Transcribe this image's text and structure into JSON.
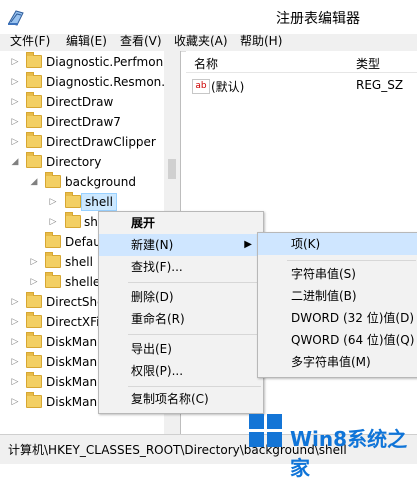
{
  "window": {
    "title": "注册表编辑器"
  },
  "menu": [
    "文件(F)",
    "编辑(E)",
    "查看(V)",
    "收藏夹(A)",
    "帮助(H)"
  ],
  "tree": [
    {
      "label": "Diagnostic.Perfmon.",
      "arrow": "▷"
    },
    {
      "label": "Diagnostic.Resmon.C",
      "arrow": "▷"
    },
    {
      "label": "DirectDraw",
      "arrow": "▷"
    },
    {
      "label": "DirectDraw7",
      "arrow": "▷"
    },
    {
      "label": "DirectDrawClipper",
      "arrow": "▷"
    },
    {
      "label": "Directory",
      "arrow": "◢"
    },
    {
      "label": "background",
      "arrow": "◢"
    },
    {
      "label": "shell",
      "arrow": "▷"
    },
    {
      "label": "sh",
      "arrow": "▷"
    },
    {
      "label": "Defau",
      "arrow": ""
    },
    {
      "label": "shell",
      "arrow": "▷"
    },
    {
      "label": "shelle",
      "arrow": "▷"
    },
    {
      "label": "DirectSho",
      "arrow": "▷"
    },
    {
      "label": "DirectXFi",
      "arrow": "▷"
    },
    {
      "label": "DiskMan",
      "arrow": "▷"
    },
    {
      "label": "DiskMan",
      "arrow": "▷"
    },
    {
      "label": "DiskMan",
      "arrow": "▷"
    },
    {
      "label": "DiskMan",
      "arrow": "▷"
    }
  ],
  "values": {
    "name_header": "名称",
    "type_header": "类型",
    "row": {
      "name": "(默认)",
      "type": "REG_SZ",
      "icon_text": "ab"
    }
  },
  "context_menu": [
    "展开",
    "新建(N)",
    "查找(F)...",
    "删除(D)",
    "重命名(R)",
    "导出(E)",
    "权限(P)...",
    "复制项名称(C)"
  ],
  "submenu": [
    "项(K)",
    "字符串值(S)",
    "二进制值(B)",
    "DWORD (32 位)值(D)",
    "QWORD (64 位)值(Q)",
    "多字符串值(M)"
  ],
  "status": {
    "path": "计算机\\HKEY_CLASSES_ROOT\\Directory\\background\\shell"
  },
  "watermark": {
    "text": "Win8系统之家"
  }
}
